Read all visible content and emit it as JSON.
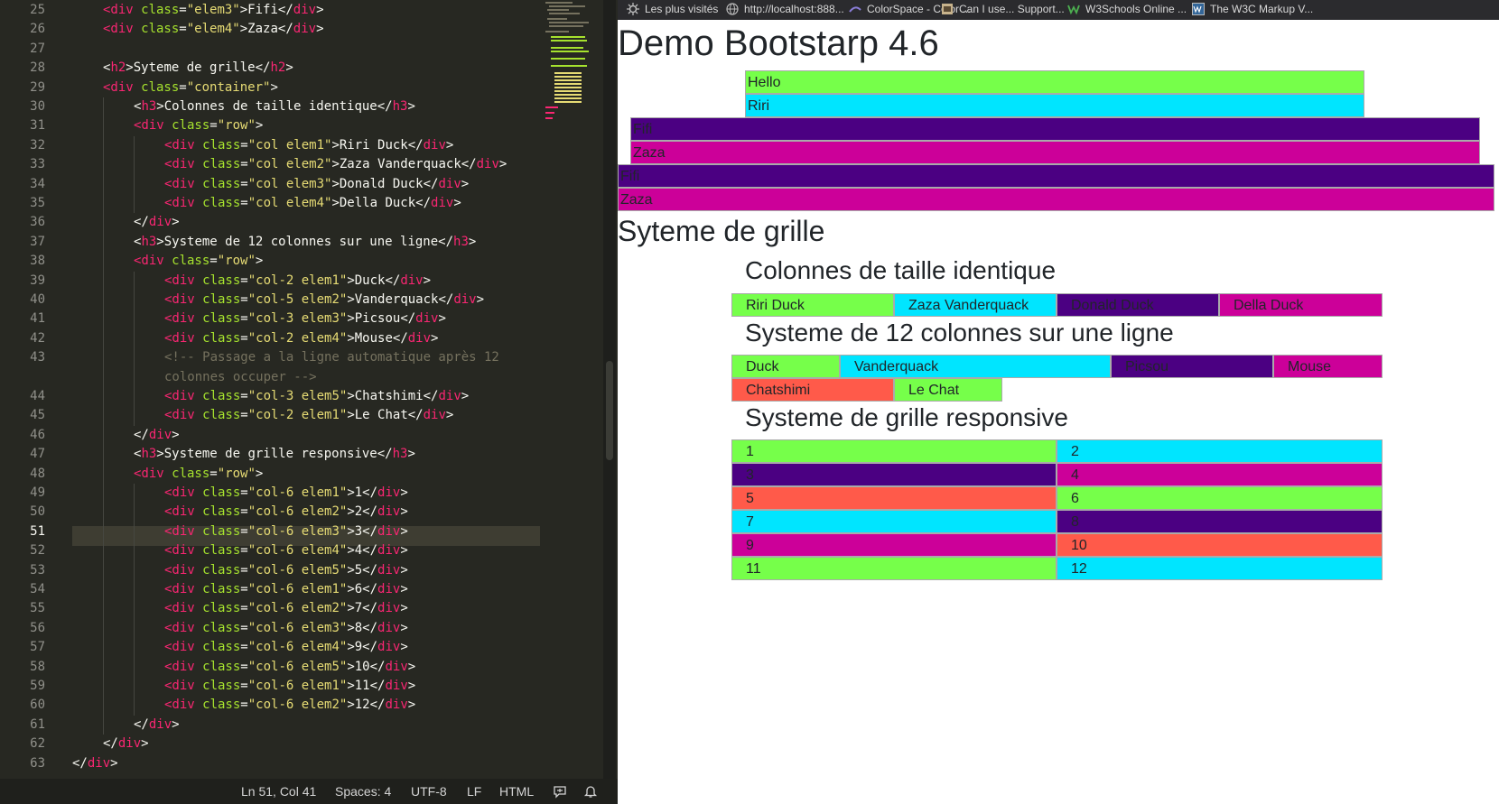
{
  "editor": {
    "lines": [
      {
        "n": "25",
        "indent": 1,
        "tokens": [
          [
            "t",
            "<div"
          ],
          [
            "a",
            " class"
          ],
          [
            "p",
            "="
          ],
          [
            "s",
            "\"elem3\""
          ],
          [
            "p",
            ">Fifi</"
          ],
          [
            "t",
            "div"
          ],
          [
            "p",
            ">"
          ]
        ]
      },
      {
        "n": "26",
        "indent": 1,
        "tokens": [
          [
            "t",
            "<div"
          ],
          [
            "a",
            " class"
          ],
          [
            "p",
            "="
          ],
          [
            "s",
            "\"elem4\""
          ],
          [
            "p",
            ">Zaza</"
          ],
          [
            "t",
            "div"
          ],
          [
            "p",
            ">"
          ]
        ]
      },
      {
        "n": "27",
        "indent": 0,
        "tokens": []
      },
      {
        "n": "28",
        "indent": 1,
        "tokens": [
          [
            "p",
            "<"
          ],
          [
            "t",
            "h2"
          ],
          [
            "p",
            ">Syteme de grille</"
          ],
          [
            "t",
            "h2"
          ],
          [
            "p",
            ">"
          ]
        ]
      },
      {
        "n": "29",
        "indent": 1,
        "tokens": [
          [
            "t",
            "<div"
          ],
          [
            "a",
            " class"
          ],
          [
            "p",
            "="
          ],
          [
            "s",
            "\"container\""
          ],
          [
            "p",
            ">"
          ]
        ]
      },
      {
        "n": "30",
        "indent": 2,
        "tokens": [
          [
            "p",
            "<"
          ],
          [
            "t",
            "h3"
          ],
          [
            "p",
            ">Colonnes de taille identique</"
          ],
          [
            "t",
            "h3"
          ],
          [
            "p",
            ">"
          ]
        ]
      },
      {
        "n": "31",
        "indent": 2,
        "tokens": [
          [
            "t",
            "<div"
          ],
          [
            "a",
            " class"
          ],
          [
            "p",
            "="
          ],
          [
            "s",
            "\"row\""
          ],
          [
            "p",
            ">"
          ]
        ]
      },
      {
        "n": "32",
        "indent": 3,
        "tokens": [
          [
            "t",
            "<div"
          ],
          [
            "a",
            " class"
          ],
          [
            "p",
            "="
          ],
          [
            "s",
            "\"col elem1\""
          ],
          [
            "p",
            ">Riri Duck</"
          ],
          [
            "t",
            "div"
          ],
          [
            "p",
            ">"
          ]
        ]
      },
      {
        "n": "33",
        "indent": 3,
        "tokens": [
          [
            "t",
            "<div"
          ],
          [
            "a",
            " class"
          ],
          [
            "p",
            "="
          ],
          [
            "s",
            "\"col elem2\""
          ],
          [
            "p",
            ">Zaza Vanderquack</"
          ],
          [
            "t",
            "div"
          ],
          [
            "p",
            ">"
          ]
        ]
      },
      {
        "n": "34",
        "indent": 3,
        "tokens": [
          [
            "t",
            "<div"
          ],
          [
            "a",
            " class"
          ],
          [
            "p",
            "="
          ],
          [
            "s",
            "\"col elem3\""
          ],
          [
            "p",
            ">Donald Duck</"
          ],
          [
            "t",
            "div"
          ],
          [
            "p",
            ">"
          ]
        ]
      },
      {
        "n": "35",
        "indent": 3,
        "tokens": [
          [
            "t",
            "<div"
          ],
          [
            "a",
            " class"
          ],
          [
            "p",
            "="
          ],
          [
            "s",
            "\"col elem4\""
          ],
          [
            "p",
            ">Della Duck</"
          ],
          [
            "t",
            "div"
          ],
          [
            "p",
            ">"
          ]
        ]
      },
      {
        "n": "36",
        "indent": 2,
        "tokens": [
          [
            "p",
            "</"
          ],
          [
            "t",
            "div"
          ],
          [
            "p",
            ">"
          ]
        ]
      },
      {
        "n": "37",
        "indent": 2,
        "tokens": [
          [
            "p",
            "<"
          ],
          [
            "t",
            "h3"
          ],
          [
            "p",
            ">Systeme de 12 colonnes sur une ligne</"
          ],
          [
            "t",
            "h3"
          ],
          [
            "p",
            ">"
          ]
        ]
      },
      {
        "n": "38",
        "indent": 2,
        "tokens": [
          [
            "t",
            "<div"
          ],
          [
            "a",
            " class"
          ],
          [
            "p",
            "="
          ],
          [
            "s",
            "\"row\""
          ],
          [
            "p",
            ">"
          ]
        ]
      },
      {
        "n": "39",
        "indent": 3,
        "tokens": [
          [
            "t",
            "<div"
          ],
          [
            "a",
            " class"
          ],
          [
            "p",
            "="
          ],
          [
            "s",
            "\"col-2 elem1\""
          ],
          [
            "p",
            ">Duck</"
          ],
          [
            "t",
            "div"
          ],
          [
            "p",
            ">"
          ]
        ]
      },
      {
        "n": "40",
        "indent": 3,
        "tokens": [
          [
            "t",
            "<div"
          ],
          [
            "a",
            " class"
          ],
          [
            "p",
            "="
          ],
          [
            "s",
            "\"col-5 elem2\""
          ],
          [
            "p",
            ">Vanderquack</"
          ],
          [
            "t",
            "div"
          ],
          [
            "p",
            ">"
          ]
        ]
      },
      {
        "n": "41",
        "indent": 3,
        "tokens": [
          [
            "t",
            "<div"
          ],
          [
            "a",
            " class"
          ],
          [
            "p",
            "="
          ],
          [
            "s",
            "\"col-3 elem3\""
          ],
          [
            "p",
            ">Picsou</"
          ],
          [
            "t",
            "div"
          ],
          [
            "p",
            ">"
          ]
        ]
      },
      {
        "n": "42",
        "indent": 3,
        "tokens": [
          [
            "t",
            "<div"
          ],
          [
            "a",
            " class"
          ],
          [
            "p",
            "="
          ],
          [
            "s",
            "\"col-2 elem4\""
          ],
          [
            "p",
            ">Mouse</"
          ],
          [
            "t",
            "div"
          ],
          [
            "p",
            ">"
          ]
        ]
      },
      {
        "n": "43",
        "indent": 3,
        "tokens": [
          [
            "c",
            "<!-- Passage a la ligne automatique après 12"
          ]
        ]
      },
      {
        "n": "",
        "indent": 3,
        "tokens": [
          [
            "c",
            "colonnes occuper -->"
          ]
        ]
      },
      {
        "n": "44",
        "indent": 3,
        "tokens": [
          [
            "t",
            "<div"
          ],
          [
            "a",
            " class"
          ],
          [
            "p",
            "="
          ],
          [
            "s",
            "\"col-3 elem5\""
          ],
          [
            "p",
            ">Chatshimi</"
          ],
          [
            "t",
            "div"
          ],
          [
            "p",
            ">"
          ]
        ]
      },
      {
        "n": "45",
        "indent": 3,
        "tokens": [
          [
            "t",
            "<div"
          ],
          [
            "a",
            " class"
          ],
          [
            "p",
            "="
          ],
          [
            "s",
            "\"col-2 elem1\""
          ],
          [
            "p",
            ">Le Chat</"
          ],
          [
            "t",
            "div"
          ],
          [
            "p",
            ">"
          ]
        ]
      },
      {
        "n": "46",
        "indent": 2,
        "tokens": [
          [
            "p",
            "</"
          ],
          [
            "t",
            "div"
          ],
          [
            "p",
            ">"
          ]
        ]
      },
      {
        "n": "47",
        "indent": 2,
        "tokens": [
          [
            "p",
            "<"
          ],
          [
            "t",
            "h3"
          ],
          [
            "p",
            ">Systeme de grille responsive</"
          ],
          [
            "t",
            "h3"
          ],
          [
            "p",
            ">"
          ]
        ]
      },
      {
        "n": "48",
        "indent": 2,
        "tokens": [
          [
            "t",
            "<div"
          ],
          [
            "a",
            " class"
          ],
          [
            "p",
            "="
          ],
          [
            "s",
            "\"row\""
          ],
          [
            "p",
            ">"
          ]
        ]
      },
      {
        "n": "49",
        "indent": 3,
        "tokens": [
          [
            "t",
            "<div"
          ],
          [
            "a",
            " class"
          ],
          [
            "p",
            "="
          ],
          [
            "s",
            "\"col-6 elem1\""
          ],
          [
            "p",
            ">1</"
          ],
          [
            "t",
            "div"
          ],
          [
            "p",
            ">"
          ]
        ]
      },
      {
        "n": "50",
        "indent": 3,
        "tokens": [
          [
            "t",
            "<div"
          ],
          [
            "a",
            " class"
          ],
          [
            "p",
            "="
          ],
          [
            "s",
            "\"col-6 elem2\""
          ],
          [
            "p",
            ">2</"
          ],
          [
            "t",
            "div"
          ],
          [
            "p",
            ">"
          ]
        ]
      },
      {
        "n": "51",
        "indent": 3,
        "cur": true,
        "tokens": [
          [
            "t",
            "<div"
          ],
          [
            "a",
            " class"
          ],
          [
            "p",
            "="
          ],
          [
            "s",
            "\"col-6 elem3\""
          ],
          [
            "p",
            ">3</"
          ],
          [
            "t",
            "div"
          ],
          [
            "p",
            ">"
          ]
        ]
      },
      {
        "n": "52",
        "indent": 3,
        "tokens": [
          [
            "t",
            "<div"
          ],
          [
            "a",
            " class"
          ],
          [
            "p",
            "="
          ],
          [
            "s",
            "\"col-6 elem4\""
          ],
          [
            "p",
            ">4</"
          ],
          [
            "t",
            "div"
          ],
          [
            "p",
            ">"
          ]
        ]
      },
      {
        "n": "53",
        "indent": 3,
        "tokens": [
          [
            "t",
            "<div"
          ],
          [
            "a",
            " class"
          ],
          [
            "p",
            "="
          ],
          [
            "s",
            "\"col-6 elem5\""
          ],
          [
            "p",
            ">5</"
          ],
          [
            "t",
            "div"
          ],
          [
            "p",
            ">"
          ]
        ]
      },
      {
        "n": "54",
        "indent": 3,
        "tokens": [
          [
            "t",
            "<div"
          ],
          [
            "a",
            " class"
          ],
          [
            "p",
            "="
          ],
          [
            "s",
            "\"col-6 elem1\""
          ],
          [
            "p",
            ">6</"
          ],
          [
            "t",
            "div"
          ],
          [
            "p",
            ">"
          ]
        ]
      },
      {
        "n": "55",
        "indent": 3,
        "tokens": [
          [
            "t",
            "<div"
          ],
          [
            "a",
            " class"
          ],
          [
            "p",
            "="
          ],
          [
            "s",
            "\"col-6 elem2\""
          ],
          [
            "p",
            ">7</"
          ],
          [
            "t",
            "div"
          ],
          [
            "p",
            ">"
          ]
        ]
      },
      {
        "n": "56",
        "indent": 3,
        "tokens": [
          [
            "t",
            "<div"
          ],
          [
            "a",
            " class"
          ],
          [
            "p",
            "="
          ],
          [
            "s",
            "\"col-6 elem3\""
          ],
          [
            "p",
            ">8</"
          ],
          [
            "t",
            "div"
          ],
          [
            "p",
            ">"
          ]
        ]
      },
      {
        "n": "57",
        "indent": 3,
        "tokens": [
          [
            "t",
            "<div"
          ],
          [
            "a",
            " class"
          ],
          [
            "p",
            "="
          ],
          [
            "s",
            "\"col-6 elem4\""
          ],
          [
            "p",
            ">9</"
          ],
          [
            "t",
            "div"
          ],
          [
            "p",
            ">"
          ]
        ]
      },
      {
        "n": "58",
        "indent": 3,
        "tokens": [
          [
            "t",
            "<div"
          ],
          [
            "a",
            " class"
          ],
          [
            "p",
            "="
          ],
          [
            "s",
            "\"col-6 elem5\""
          ],
          [
            "p",
            ">10</"
          ],
          [
            "t",
            "div"
          ],
          [
            "p",
            ">"
          ]
        ]
      },
      {
        "n": "59",
        "indent": 3,
        "tokens": [
          [
            "t",
            "<div"
          ],
          [
            "a",
            " class"
          ],
          [
            "p",
            "="
          ],
          [
            "s",
            "\"col-6 elem1\""
          ],
          [
            "p",
            ">11</"
          ],
          [
            "t",
            "div"
          ],
          [
            "p",
            ">"
          ]
        ]
      },
      {
        "n": "60",
        "indent": 3,
        "tokens": [
          [
            "t",
            "<div"
          ],
          [
            "a",
            " class"
          ],
          [
            "p",
            "="
          ],
          [
            "s",
            "\"col-6 elem2\""
          ],
          [
            "p",
            ">12</"
          ],
          [
            "t",
            "div"
          ],
          [
            "p",
            ">"
          ]
        ]
      },
      {
        "n": "61",
        "indent": 2,
        "tokens": [
          [
            "p",
            "</"
          ],
          [
            "t",
            "div"
          ],
          [
            "p",
            ">"
          ]
        ]
      },
      {
        "n": "62",
        "indent": 1,
        "tokens": [
          [
            "p",
            "</"
          ],
          [
            "t",
            "div"
          ],
          [
            "p",
            ">"
          ]
        ]
      },
      {
        "n": "63",
        "indent": 0,
        "tokens": [
          [
            "p",
            "</"
          ],
          [
            "t",
            "div"
          ],
          [
            "p",
            ">"
          ]
        ]
      }
    ],
    "syntax_colors": {
      "tag": "#f92672",
      "attr": "#a6e22e",
      "string": "#e6db74",
      "plain": "#f8f8f2",
      "comment": "#75715e",
      "background": "#272822"
    }
  },
  "statusbar": {
    "position": "Ln 51, Col 41",
    "spaces": "Spaces: 4",
    "encoding": "UTF-8",
    "line_ending": "LF",
    "language": "HTML",
    "icons": [
      "feedback-icon",
      "bell-icon"
    ]
  },
  "bookmarks": [
    {
      "label": "Les plus visités",
      "icon": "gear-icon"
    },
    {
      "label": "http://localhost:888...",
      "icon": "globe-icon"
    },
    {
      "label": "ColorSpace - Color ...",
      "icon": "colorspace-icon"
    },
    {
      "label": "Can I use... Support...",
      "icon": "caniuse-icon"
    },
    {
      "label": "W3Schools Online ...",
      "icon": "w3schools-icon"
    },
    {
      "label": "The W3C Markup V...",
      "icon": "w3c-icon"
    }
  ],
  "page": {
    "title": "Demo Bootstarp 4.6",
    "top_items": [
      "Hello",
      "Riri",
      "Fifi",
      "Zaza",
      "Fifi",
      "Zaza"
    ],
    "h2": "Syteme de grille",
    "section1": {
      "title": "Colonnes de taille identique",
      "cells": [
        "Riri Duck",
        "Zaza Vanderquack",
        "Donald Duck",
        "Della Duck"
      ]
    },
    "section2": {
      "title": "Systeme de 12 colonnes sur une ligne",
      "cells": [
        "Duck",
        "Vanderquack",
        "Picsou",
        "Mouse",
        "Chatshimi",
        "Le Chat"
      ]
    },
    "section3": {
      "title": "Systeme de grille responsive",
      "cells": [
        "1",
        "2",
        "3",
        "4",
        "5",
        "6",
        "7",
        "8",
        "9",
        "10",
        "11",
        "12"
      ]
    }
  },
  "colors": {
    "elem1": "#76ff4a",
    "elem2": "#00e5ff",
    "elem3": "#4b0082",
    "elem4": "#cc0099",
    "elem5": "#ff5a4a"
  }
}
